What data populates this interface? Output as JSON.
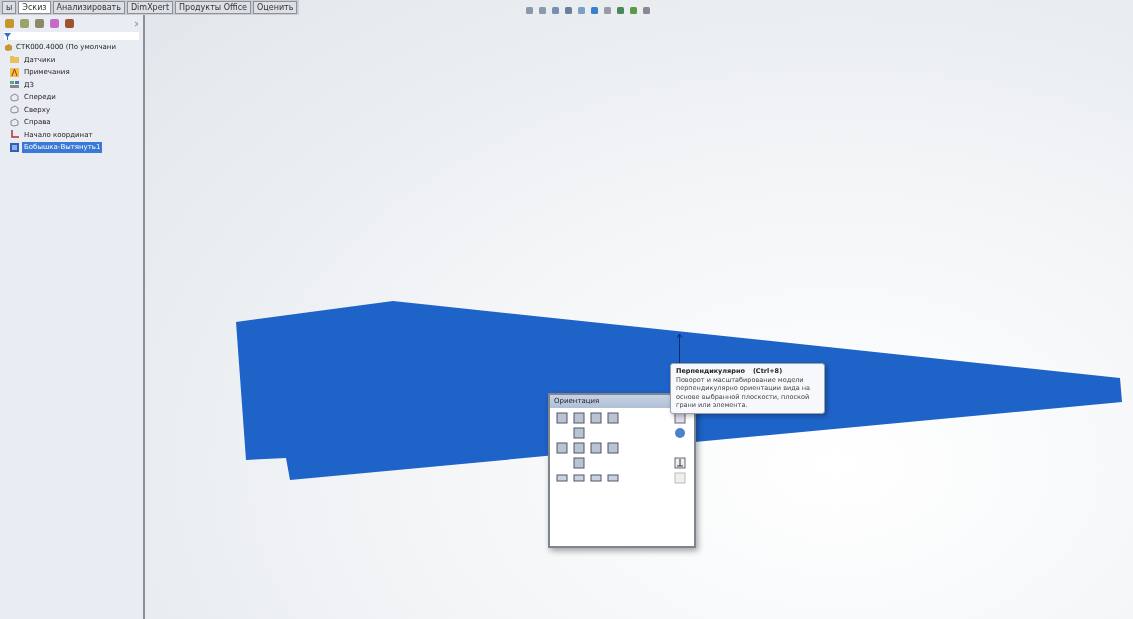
{
  "command_tabs": [
    {
      "label": "ы",
      "selected": false
    },
    {
      "label": "Эскиз",
      "selected": true
    },
    {
      "label": "Анализировать",
      "selected": false
    },
    {
      "label": "DimXpert",
      "selected": false
    },
    {
      "label": "Продукты Office",
      "selected": false
    },
    {
      "label": "Оценить",
      "selected": false
    }
  ],
  "feature_tree": {
    "root": "СТК000.4000 (По умолчани",
    "items": [
      {
        "kind": "folder",
        "label": "Датчики",
        "selected": false
      },
      {
        "kind": "annotation",
        "label": "Примечания",
        "selected": false
      },
      {
        "kind": "material",
        "label": "Д3",
        "selected": false
      },
      {
        "kind": "plane",
        "label": "Спереди",
        "selected": false
      },
      {
        "kind": "plane",
        "label": "Сверху",
        "selected": false
      },
      {
        "kind": "plane",
        "label": "Справа",
        "selected": false
      },
      {
        "kind": "origin",
        "label": "Начало координат",
        "selected": false
      },
      {
        "kind": "feature",
        "label": "Бобышка-Вытянуть1",
        "selected": true
      }
    ]
  },
  "orientation_dialog": {
    "title": "Ориентация"
  },
  "tooltip": {
    "title": "Перпендикулярно",
    "shortcut": "(Ctrl+8)",
    "description": "Поворот и масштабирование модели перпендикулярно ориентации вида на основе выбранной плоскости, плоской грани или элемента."
  }
}
